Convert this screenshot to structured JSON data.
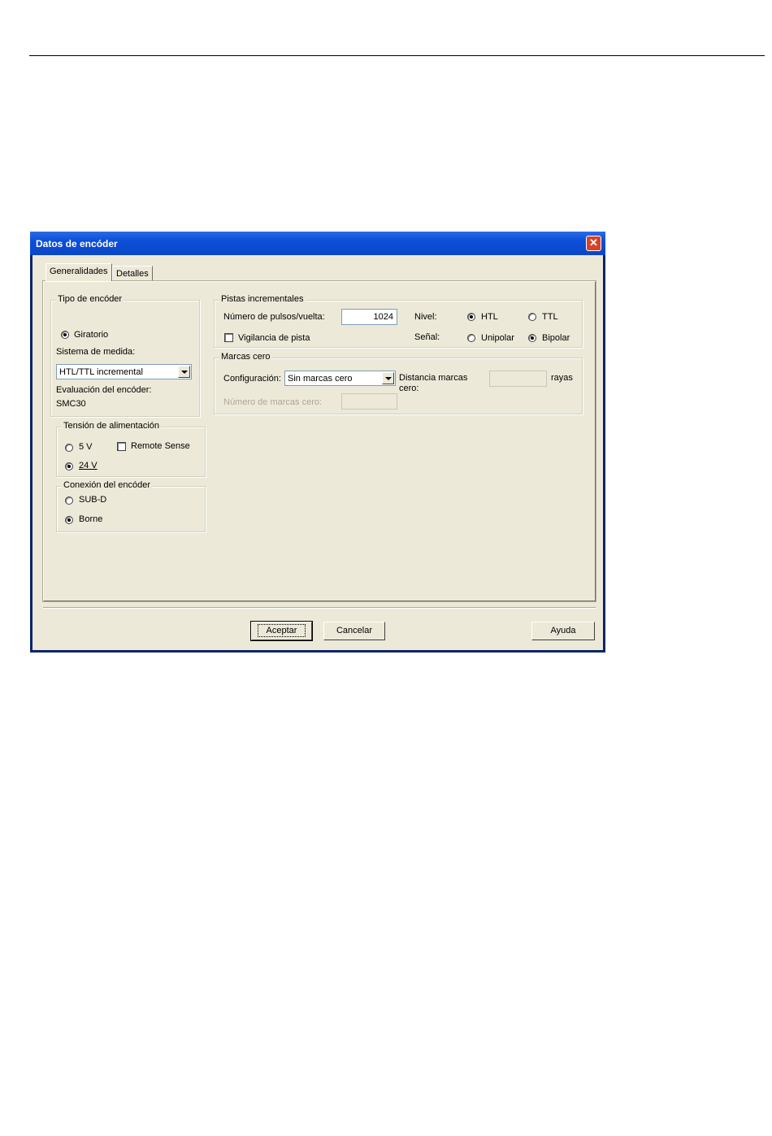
{
  "dialog": {
    "title": "Datos de encóder",
    "close_glyph": "✕"
  },
  "tabs": [
    "Generalidades",
    "Detalles"
  ],
  "encoder_type": {
    "legend": "Tipo de encóder",
    "option": "Giratorio",
    "measure_label": "Sistema de medida:",
    "measure_value": "HTL/TTL incremental",
    "evaluation_label": "Evaluación del encóder:",
    "evaluation_value": "SMC30"
  },
  "supply": {
    "legend": "Tensión de alimentación",
    "option_5v": "5 V",
    "option_24v": "24 V",
    "remote_sense": "Remote Sense",
    "selected": "24 V"
  },
  "connection": {
    "legend": "Conexión del encóder",
    "option_subd": "SUB-D",
    "option_borne": "Borne",
    "selected": "Borne"
  },
  "incremental": {
    "legend": "Pistas incrementales",
    "pulses_label": "Número de pulsos/vuelta:",
    "pulses_value": "1024",
    "track_monitor": "Vigilancia de pista",
    "level_label": "Nivel:",
    "level_htl": "HTL",
    "level_ttl": "TTL",
    "level_selected": "HTL",
    "signal_label": "Señal:",
    "signal_unipolar": "Unipolar",
    "signal_bipolar": "Bipolar",
    "signal_selected": "Bipolar"
  },
  "zero_marks": {
    "legend": "Marcas cero",
    "config_label": "Configuración:",
    "config_value": "Sin marcas cero",
    "distance_label_1": "Distancia marcas",
    "distance_label_2": "cero:",
    "distance_unit": "rayas",
    "count_label": "Número de marcas cero:"
  },
  "buttons": {
    "ok": "Aceptar",
    "cancel": "Cancelar",
    "help": "Ayuda"
  }
}
